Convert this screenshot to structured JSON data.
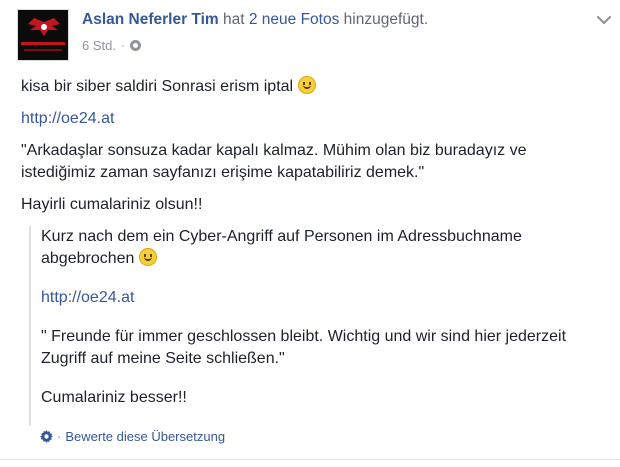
{
  "post": {
    "author": "Aslan Neferler Tim",
    "action_prefix": "hat",
    "action_link": "2 neue Fotos",
    "action_suffix": "hinzugefügt.",
    "time": "6 Std.",
    "separator": "·",
    "lines": [
      "kisa bir siber saldiri Sonrasi erism iptal",
      "http://oe24.at",
      "\"Arkadaşlar sonsuza kadar kapalı kalmaz. Mühim olan biz buradayız ve istediğimiz zaman sayfanızı erişime kapatabiliriz demek.\"",
      "Hayirli cumalariniz olsun!!"
    ]
  },
  "translation": {
    "lines": [
      "Kurz nach dem ein Cyber-Angriff auf Personen im Adressbuchname abgebrochen",
      "http://oe24.at",
      "\" Freunde für immer geschlossen bleibt. Wichtig und wir sind hier jederzeit Zugriff auf meine Seite schließen.\"",
      "Cumalariniz besser!!"
    ],
    "rate_label": "Bewerte diese Übersetzung",
    "rate_separator": "·"
  },
  "icons": {
    "avatar": "page-logo-icon",
    "chevron": "chevron-down-icon",
    "globe": "globe-icon",
    "emoji": "smiley-emoji-icon",
    "gear": "gear-icon"
  },
  "colors": {
    "link": "#365899",
    "meta": "#90949c",
    "text": "#1d2129"
  }
}
